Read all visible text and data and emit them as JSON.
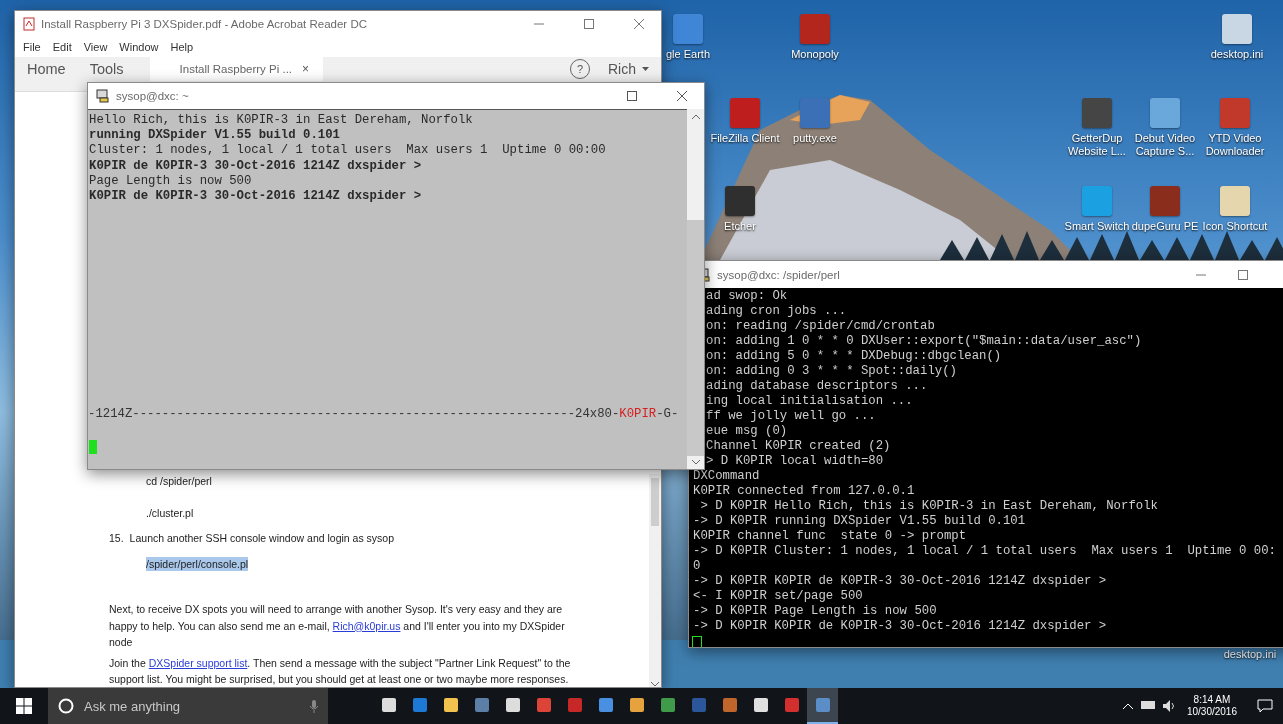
{
  "desktop_icons": [
    {
      "label": "gle Earth",
      "color": "#3f86d6"
    },
    {
      "label": "Monopoly",
      "color": "#b3261e"
    },
    {
      "label": "desktop.ini",
      "color": "#c9d6e3"
    },
    {
      "label": "FileZilla Client",
      "color": "#bf1e1e"
    },
    {
      "label": "putty.exe",
      "color": "#3b6fb6"
    },
    {
      "label": "Etcher",
      "color": "#2f2f2f"
    },
    {
      "label": "GetterDup Website L...",
      "color": "#454545"
    },
    {
      "label": "Debut Video Capture S...",
      "color": "#6aa8dc"
    },
    {
      "label": "YTD Video Downloader",
      "color": "#c0392b"
    },
    {
      "label": "Smart Switch",
      "color": "#1ba1e2"
    },
    {
      "label": "dupeGuru PE",
      "color": "#8b2d1c"
    },
    {
      "label": "Icon Shortcut",
      "color": "#e6d6ae"
    },
    {
      "label": "desktop.ini"
    }
  ],
  "acrobat": {
    "title": "Install Raspberry Pi 3 DXSpider.pdf - Adobe Acrobat Reader DC",
    "menu": [
      "File",
      "Edit",
      "View",
      "Window",
      "Help"
    ],
    "toolbar": {
      "home": "Home",
      "tools": "Tools",
      "tab": "Install Raspberry Pi ...",
      "tab_close": "×",
      "help": "?",
      "user": "Rich"
    },
    "content": [
      {
        "kind": "code",
        "text": "cd /spider/perl",
        "highlighted": false
      },
      {
        "kind": "code",
        "text": "./cluster.pl",
        "highlighted": false
      },
      {
        "kind": "step",
        "number": "15.",
        "text": "Launch another SSH console window and login as sysop"
      },
      {
        "kind": "code",
        "text": "/spider/perl/console.pl",
        "highlighted": true
      },
      {
        "kind": "paragraph",
        "parts": [
          {
            "text": "Next, to receive DX spots you will need to arrange with another Sysop. It's very easy and they are happy to help. You can also send me an e-mail, ",
            "link": false
          },
          {
            "text": "Rich@k0pir.us",
            "link": true
          },
          {
            "text": " and I'll enter you into my DXSpider node",
            "link": false
          }
        ]
      },
      {
        "kind": "paragraph",
        "parts": [
          {
            "text": "Join the ",
            "link": false
          },
          {
            "text": "DXSpider support list",
            "link": true
          },
          {
            "text": ". Then send a message with the subject \"Partner Link Request\" to the support list. You might be surprised, but you should get at least one or two maybe more responses.",
            "link": false
          }
        ]
      }
    ]
  },
  "console": {
    "title": "sysop@dxc: ~",
    "lines": [
      {
        "text": "Hello Rich, this is K0PIR-3 in East Dereham, Norfolk",
        "bold": false
      },
      {
        "text": "running DXSpider V1.55 build 0.101",
        "bold": true
      },
      {
        "text": "Cluster: 1 nodes, 1 local / 1 total users  Max users 1  Uptime 0 00:00",
        "bold": false
      },
      {
        "text": "K0PIR de K0PIR-3 30-Oct-2016 1214Z dxspider >",
        "bold": true
      },
      {
        "text": "Page Length is now 500",
        "bold": false
      },
      {
        "text": "K0PIR de K0PIR-3 30-Oct-2016 1214Z dxspider >",
        "bold": true
      }
    ],
    "status_line": [
      {
        "text": "-1214Z------------------------------------------------------------24x80-",
        "kind": "normal"
      },
      {
        "text": "K0PIR",
        "kind": "alert"
      },
      {
        "text": "-G-",
        "kind": "normal"
      }
    ]
  },
  "server": {
    "title": "sysop@dxc: /spider/perl",
    "lines": [
      "ad swop: Ok",
      "ading cron jobs ...",
      "on: reading /spider/cmd/crontab",
      "on: adding 1 0 * * 0 DXUser::export(\"$main::data/user_asc\")",
      "on: adding 5 0 * * * DXDebug::dbgclean()",
      "on: adding 0 3 * * * Spot::daily()",
      "ading database descriptors ...",
      "ing local initialisation ...",
      "ff we jolly well go ...",
      "eue msg (0)",
      "Channel K0PIR created (2)",
      "> D K0PIR local width=80",
      "DXCommand",
      "K0PIR connected from 127.0.0.1",
      " > D K0PIR Hello Rich, this is K0PIR-3 in East Dereham, Norfolk",
      "-> D K0PIR running DXSpider V1.55 build 0.101",
      "K0PIR channel func  state 0 -> prompt",
      "-> D K0PIR Cluster: 1 nodes, 1 local / 1 total users  Max users 1  Uptime 0 00:",
      "0",
      "-> D K0PIR K0PIR de K0PIR-3 30-Oct-2016 1214Z dxspider >",
      "<- I K0PIR set/page 500",
      "-> D K0PIR Page Length is now 500",
      "-> D K0PIR K0PIR de K0PIR-3 30-Oct-2016 1214Z dxspider >"
    ]
  },
  "taskbar": {
    "search": {
      "placeholder": "Ask me anything"
    },
    "apps": [
      {
        "selected": false
      },
      {
        "selected": false
      },
      {
        "selected": false
      },
      {
        "selected": false
      },
      {
        "selected": false
      },
      {
        "selected": false
      },
      {
        "selected": false
      },
      {
        "selected": false
      },
      {
        "selected": false
      },
      {
        "selected": false
      },
      {
        "selected": false
      },
      {
        "selected": false
      },
      {
        "selected": false
      },
      {
        "selected": false
      },
      {
        "selected": true
      }
    ],
    "time": "8:14 AM",
    "date": "10/30/2016"
  }
}
